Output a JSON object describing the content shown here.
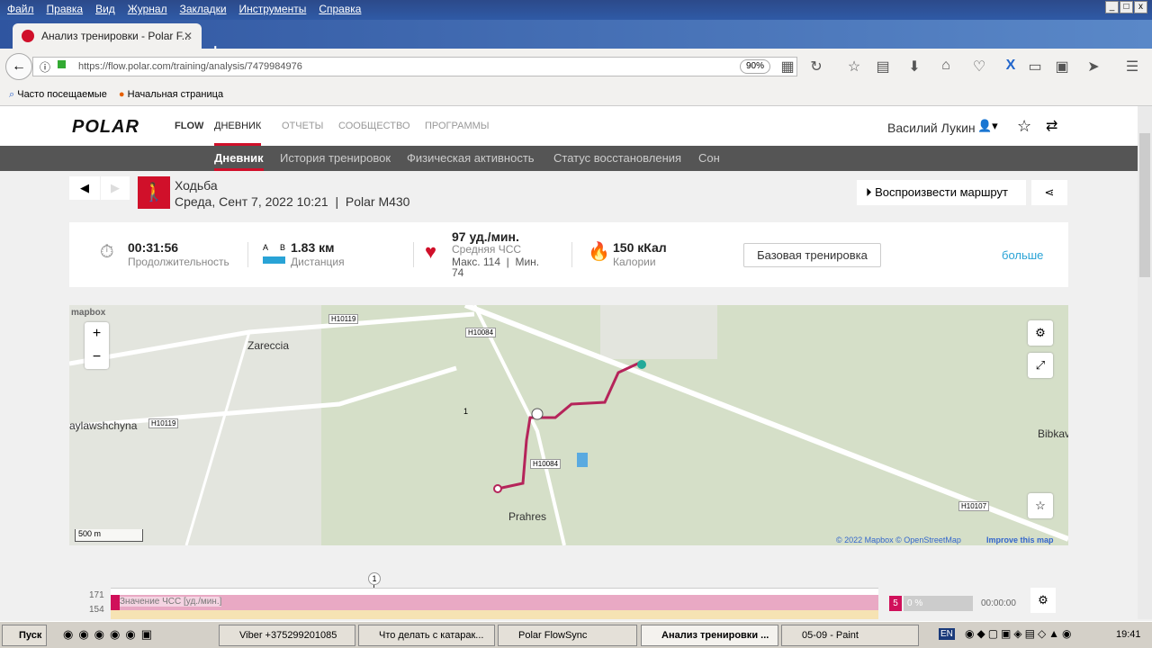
{
  "menu": [
    "Файл",
    "Правка",
    "Вид",
    "Журнал",
    "Закладки",
    "Инструменты",
    "Справка"
  ],
  "tab": {
    "title": "Анализ тренировки - Polar F...",
    "new": "+",
    "close": "✕"
  },
  "url": "https://flow.polar.com/training/analysis/7479984976",
  "zoom": "90%",
  "bookmarks": [
    "Часто посещаемые",
    "Начальная страница"
  ],
  "header": {
    "logo": "POLAR",
    "flow": "FLOW",
    "nav": [
      "ДНЕВНИК",
      "ОТЧЕТЫ",
      "СООБЩЕСТВО",
      "ПРОГРАММЫ"
    ],
    "user": "Василий Лукин"
  },
  "subnav": [
    "Дневник",
    "История тренировок",
    "Физическая активность",
    "Статус восстановления",
    "Сон"
  ],
  "session": {
    "sport": "Ходьба",
    "date": "Среда, Сент 7, 2022 10:21  |  Polar M430",
    "replay": "Воспроизвести маршрут"
  },
  "summary": {
    "duration": "00:31:56",
    "duration_label": "Продолжительность",
    "dist_a": "A",
    "dist_b": "B",
    "distance": "1.83 км",
    "distance_label": "Дистанция",
    "hr": "97 уд./мин.",
    "hr_label": "Средняя ЧСС",
    "hr_minmax": "Макс. 114  |  Мин.",
    "hr_min": "74",
    "calories": "150 кКал",
    "calories_label": "Калории",
    "base_button": "Базовая тренировка",
    "more": "больше"
  },
  "map": {
    "attribution_logo": "mapbox",
    "places": [
      "Zareccia",
      "aylawshchyna",
      "Prahres",
      "Bibkav"
    ],
    "roads": [
      "H10119",
      "H10084",
      "H10119",
      "H10084",
      "H10107"
    ],
    "scale": "500 m",
    "copyright": "© 2022 Mapbox © OpenStreetMap",
    "improve": "Improve this map",
    "lap_marker": "1",
    "zoom_in": "+",
    "zoom_out": "−"
  },
  "chart": {
    "marker": "1",
    "y_ticks": [
      "171",
      "154"
    ],
    "label": "Значение ЧСС [уд./мин.]",
    "zone": "5",
    "zone_pct": "0 %",
    "zone_time": "00:00:00"
  },
  "taskbar": {
    "start": "Пуск",
    "tasks": [
      "Viber +375299201085",
      "Что делать с катарак...",
      "Polar FlowSync",
      "Анализ тренировки ...",
      "05-09 - Paint"
    ],
    "lang": "EN",
    "time": "19:41"
  }
}
